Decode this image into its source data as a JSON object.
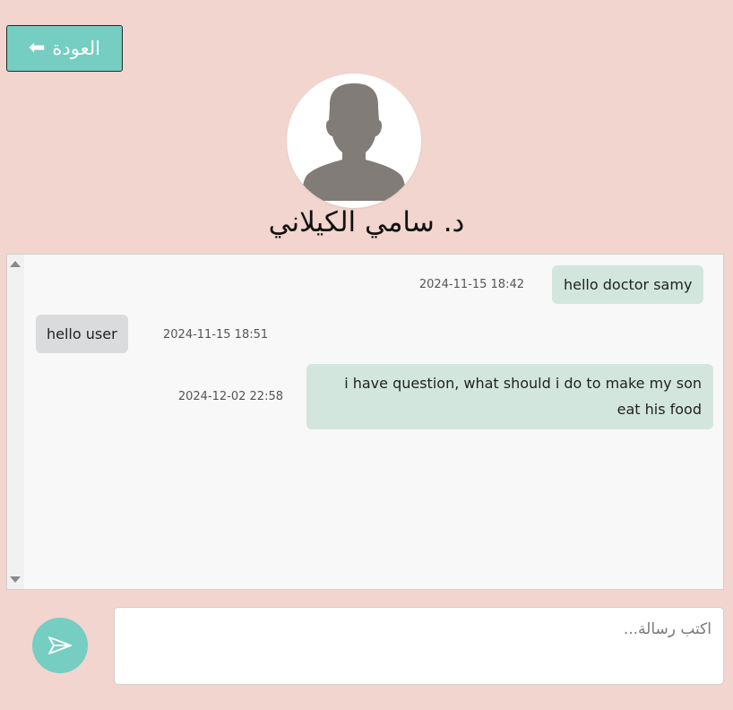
{
  "header": {
    "back_button_label": "العودة",
    "back_icon": "arrow-left-icon"
  },
  "doctor": {
    "name": "د. سامي الكيلاني",
    "avatar_icon": "user-silhouette-icon"
  },
  "messages": [
    {
      "sender": "user",
      "text": "hello doctor samy",
      "time": "2024-11-15 18:42"
    },
    {
      "sender": "doctor",
      "text": "hello user",
      "time": "2024-11-15 18:51"
    },
    {
      "sender": "user",
      "text": "i have question, what should i do to make my son eat his food",
      "time": "2024-12-02 22:58"
    }
  ],
  "composer": {
    "placeholder": "اكتب رسالة...",
    "value": "",
    "send_icon": "send-icon"
  },
  "colors": {
    "background": "#f2d5ce",
    "accent": "#76cdc2",
    "sent_bubble": "#d3e6dd",
    "received_bubble": "#d9dbdc"
  }
}
